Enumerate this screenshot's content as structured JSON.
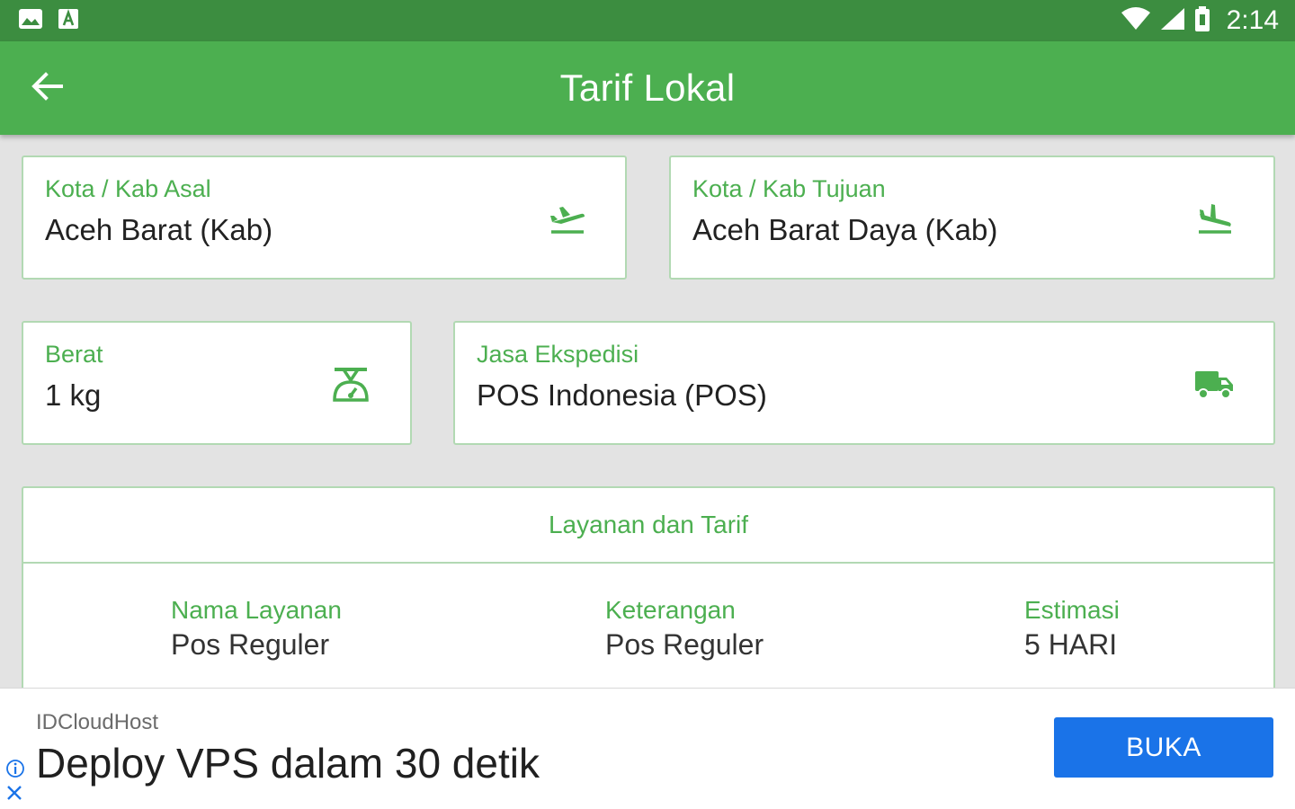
{
  "status_bar": {
    "time": "2:14",
    "icons": [
      "image-icon",
      "text-a-icon",
      "wifi-icon",
      "signal-icon",
      "battery-icon"
    ]
  },
  "app_bar": {
    "title": "Tarif Lokal",
    "back_icon": "arrow-back-icon"
  },
  "form": {
    "origin": {
      "label": "Kota / Kab Asal",
      "value": "Aceh Barat (Kab)",
      "icon": "flight-takeoff-icon"
    },
    "destination": {
      "label": "Kota / Kab Tujuan",
      "value": "Aceh Barat Daya (Kab)",
      "icon": "flight-land-icon"
    },
    "weight": {
      "label": "Berat",
      "value": "1 kg",
      "icon": "scale-icon"
    },
    "courier": {
      "label": "Jasa Ekspedisi",
      "value": "POS Indonesia (POS)",
      "icon": "truck-icon"
    }
  },
  "results": {
    "title": "Layanan dan Tarif",
    "columns": [
      {
        "label": "Nama Layanan",
        "value": "Pos Reguler"
      },
      {
        "label": "Keterangan",
        "value": "Pos Reguler"
      },
      {
        "label": "Estimasi",
        "value": "5 HARI"
      }
    ]
  },
  "ad": {
    "advertiser": "IDCloudHost",
    "headline": "Deploy VPS dalam 30 detik",
    "cta": "BUKA"
  },
  "colors": {
    "status_bar": "#3c8d40",
    "primary": "#4caf50",
    "card_border": "#b2d9b3",
    "background": "#e3e3e3",
    "ad_button": "#1a73e8"
  }
}
